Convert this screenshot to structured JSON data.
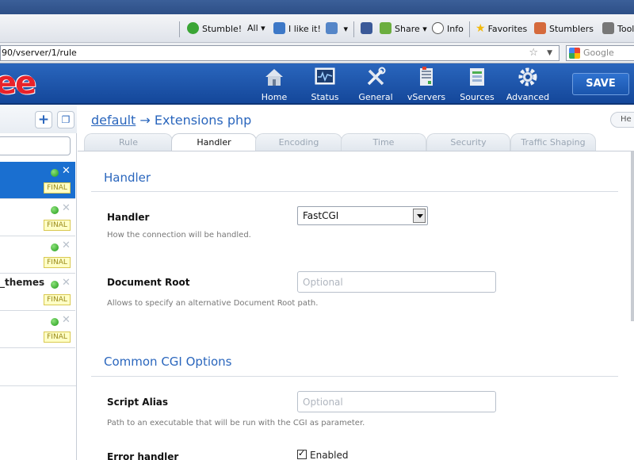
{
  "browser": {
    "toolbar": {
      "stumble": "Stumble!",
      "all": "All",
      "like": "I like it!",
      "share": "Share",
      "info": "Info",
      "favorites": "Favorites",
      "stumblers": "Stumblers",
      "tools": "Tools"
    },
    "url": "90/vserver/1/rule",
    "search_placeholder": "Google"
  },
  "app": {
    "logo_text": "ee",
    "nav": [
      {
        "label": "Home",
        "icon": "home-icon"
      },
      {
        "label": "Status",
        "icon": "status-monitor-icon"
      },
      {
        "label": "General",
        "icon": "tools-icon"
      },
      {
        "label": "vServers",
        "icon": "vservers-icon"
      },
      {
        "label": "Sources",
        "icon": "sources-icon"
      },
      {
        "label": "Advanced",
        "icon": "gear-icon"
      }
    ],
    "save_label": "SAVE"
  },
  "sidebar": {
    "rules": [
      {
        "name": "",
        "badge": "FINAL",
        "selected": true
      },
      {
        "name": "",
        "badge": "FINAL",
        "selected": false
      },
      {
        "name": "",
        "badge": "FINAL",
        "selected": false
      },
      {
        "name": "_themes",
        "badge": "FINAL",
        "selected": false
      },
      {
        "name": "",
        "badge": "FINAL",
        "selected": false
      }
    ]
  },
  "main": {
    "breadcrumb_link": "default",
    "breadcrumb_rest": "→ Extensions php",
    "help_label": "He",
    "tabs": [
      "Rule",
      "Handler",
      "Encoding",
      "Time",
      "Security",
      "Traffic Shaping"
    ],
    "active_tab": "Handler",
    "handler_section": {
      "title": "Handler",
      "handler_label": "Handler",
      "handler_value": "FastCGI",
      "handler_desc": "How the connection will be handled.",
      "docroot_label": "Document Root",
      "docroot_placeholder": "Optional",
      "docroot_desc": "Allows to specify an alternative Document Root path."
    },
    "cgi_section": {
      "title": "Common CGI Options",
      "alias_label": "Script Alias",
      "alias_placeholder": "Optional",
      "alias_desc": "Path to an executable that will be run with the CGI as parameter.",
      "error_label": "Error handler",
      "error_check_label": "Enabled"
    }
  }
}
